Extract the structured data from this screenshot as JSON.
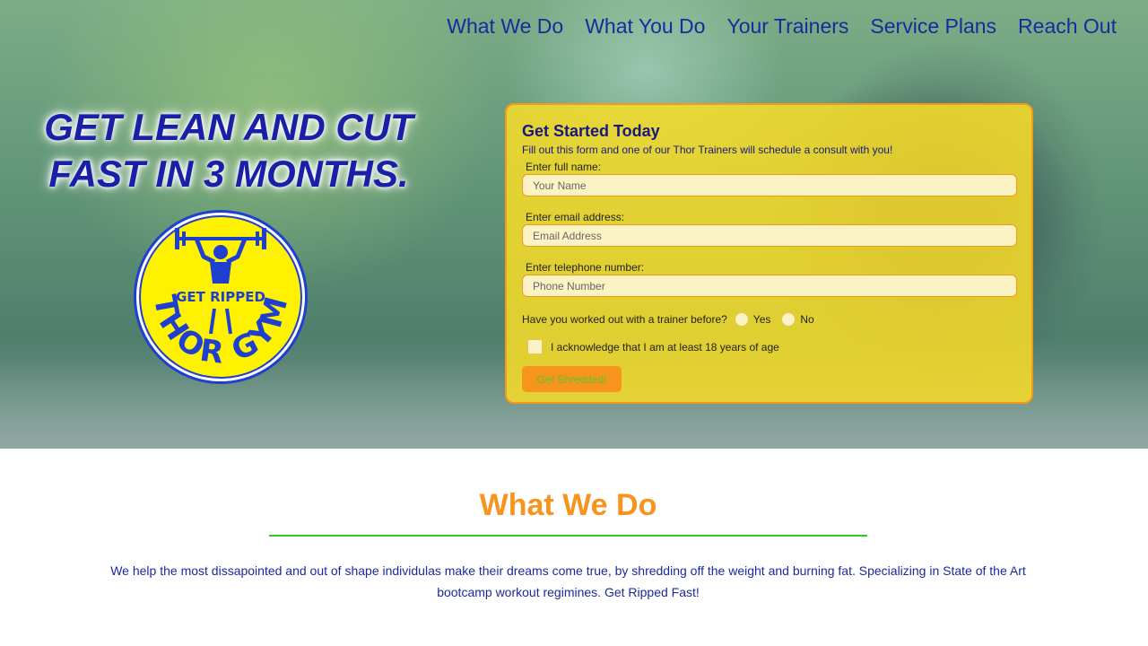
{
  "nav": {
    "items": [
      "What We Do",
      "What You Do",
      "Your Trainers",
      "Service Plans",
      "Reach Out"
    ]
  },
  "hero": {
    "headline_line1": "GET LEAN AND CUT",
    "headline_line2": "FAST IN 3 MONTHS.",
    "logo": {
      "top_text": "GET RIPPED",
      "bottom_text": "THOR GYM",
      "icon": "weightlifter-icon"
    }
  },
  "form": {
    "title": "Get Started Today",
    "subtitle": "Fill out this form and one of our Thor Trainers will schedule a consult with you!",
    "name_label": "Enter full name:",
    "name_placeholder": "Your Name",
    "email_label": "Enter email address:",
    "email_placeholder": "Email Address",
    "phone_label": "Enter telephone number:",
    "phone_placeholder": "Phone Number",
    "trainer_question": "Have you worked out with a trainer before?",
    "yes_label": "Yes",
    "no_label": "No",
    "age_ack": "I acknowledge that I am at least 18 years of age",
    "submit_label": "Get Shredded!"
  },
  "section": {
    "title": "What We Do",
    "body": "We help the most dissapointed and out of shape individulas make their dreams come true, by shredding off the weight and burning fat. Specializing in State of the Art bootcamp workout regimines. Get Ripped Fast!"
  },
  "colors": {
    "brand_blue": "#1a2a9c",
    "accent_orange": "#f7941d",
    "form_yellow": "#f8dc28",
    "rule_green": "#39c22d"
  }
}
